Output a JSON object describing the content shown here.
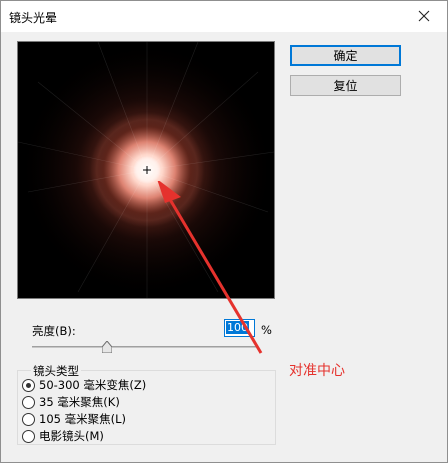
{
  "window": {
    "title": "镜头光晕"
  },
  "buttons": {
    "ok": "确定",
    "reset": "复位"
  },
  "brightness": {
    "label": "亮度(B):",
    "value": "100",
    "unit": "%",
    "level_percent": 100
  },
  "lens_type": {
    "label": "镜头类型",
    "options": [
      {
        "label": "50-300 毫米变焦(Z)",
        "checked": true
      },
      {
        "label": "35 毫米聚焦(K)",
        "checked": false
      },
      {
        "label": "105 毫米聚焦(L)",
        "checked": false
      },
      {
        "label": "电影镜头(M)",
        "checked": false
      }
    ]
  },
  "annotation": {
    "text": "对准中心",
    "color": "#e5322d"
  },
  "icons": {
    "close": "close-icon",
    "crosshair": "crosshair-icon",
    "slider": "slider-thumb-icon"
  }
}
